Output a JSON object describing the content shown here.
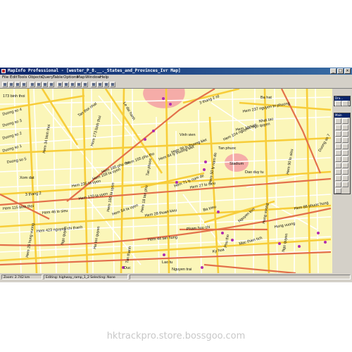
{
  "window": {
    "title": "MapInfo Professional - [wester_P_8.__._States_and_Provinces_Ivr Map]"
  },
  "menu": [
    "File",
    "Edit",
    "Tools",
    "Objects",
    "Query",
    "Table",
    "Options",
    "Map",
    "Window",
    "Help"
  ],
  "palettes": {
    "main_title": "Main",
    "drawing_title": "Dra..."
  },
  "status": {
    "zoom": "Zoom: 2.742 km",
    "editing": "Editing: highway_ramp_1_2  Selecting: None"
  },
  "map": {
    "colors": {
      "land": "#fbf6b9",
      "road": "#f7cd3a",
      "street": "#ffffff",
      "highway": "#e3704a",
      "poi_area": "#f5aca8",
      "poi_dot": "#b02cb0"
    },
    "labels": [
      "173 binh thoi",
      "Tan thoi nhat",
      "Le dai hanh",
      "3 thang 2 rd",
      "Ba hat",
      "Hem 237 nguyen tri phuong",
      "Nhat tao",
      "Hem 102 ngo quyen",
      "Hem 104 nguyen kim",
      "Duong so 4",
      "Duong so 3",
      "Duong so 2",
      "Duong so 1",
      "Duong so 5",
      "Hem 34 binh thoi",
      "Hem 173 binh thoi",
      "Hem 185 phu tho",
      "Hem 155 phu tho",
      "Hem 96 ly thuong kiet",
      "Vinh vien",
      "Tan phuoc",
      "Stadium",
      "Dao duy tu",
      "Hem 84 ly thuong kiet",
      "Hem 158 ta uyen",
      "Hem 235 ta uyen",
      "Hem 170 ta uyen",
      "Hem 165 ta uyen",
      "Hem 54 ta uyen",
      "Hem 18 tan phu",
      "Tan phuoc",
      "Hem 71 ly nam de",
      "Hem 50 ly nam de",
      "3 thang 2",
      "Xom dat",
      "Hem 115 binh thoi",
      "Hem 46 lo sieu",
      "Hem 423 nguyen chi thanh",
      "Hem 28 thuan kieu",
      "Ba trieu",
      "Nguyen kim",
      "Phu tho",
      "Tan thanh",
      "Hem 44 tan hung",
      "Pham huu chi",
      "Ky hoa",
      "Mac thien tich",
      "Hung vuong",
      "Hem 86 phuoc hung",
      "Hung vuong",
      "Ngo quyen",
      "Nguyen trai",
      "Lao tu",
      "Duong so 7",
      "Hem 27 lo sieu",
      "Hem 90 lo sieu",
      "Hem 26 hung vuong",
      "Duc",
      "Ha ton quyen",
      "Ngo quyen"
    ]
  }
}
